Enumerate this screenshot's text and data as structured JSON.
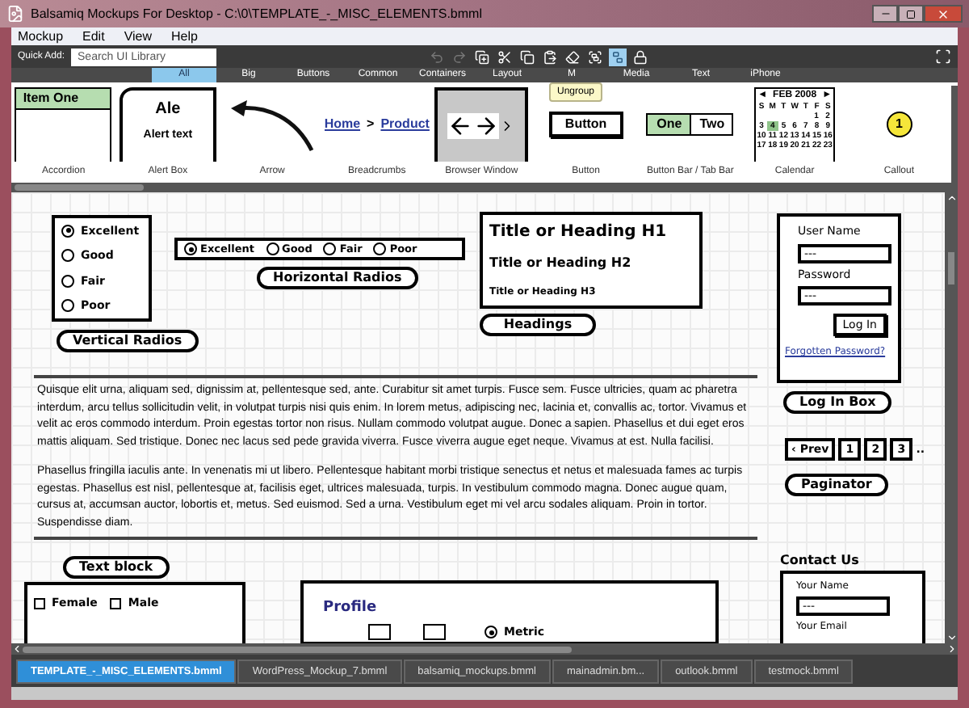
{
  "window": {
    "title": "Balsamiq Mockups For Desktop - C:\\0\\TEMPLATE_-_MISC_ELEMENTS.bmml"
  },
  "menu": [
    "Mockup",
    "Edit",
    "View",
    "Help"
  ],
  "quick_add": {
    "label": "Quick Add:",
    "placeholder": "Search UI Library"
  },
  "toolbar": [
    {
      "kind": "undo",
      "disabled": true,
      "selected": false
    },
    {
      "kind": "redo",
      "disabled": true,
      "selected": false
    },
    {
      "kind": "clone",
      "disabled": false,
      "selected": false
    },
    {
      "kind": "cut",
      "disabled": false,
      "selected": false
    },
    {
      "kind": "copy",
      "disabled": false,
      "selected": false
    },
    {
      "kind": "paste",
      "disabled": false,
      "selected": false
    },
    {
      "kind": "eraser",
      "disabled": false,
      "selected": false
    },
    {
      "kind": "group",
      "disabled": false,
      "selected": false
    },
    {
      "kind": "ungroup",
      "disabled": false,
      "selected": true
    },
    {
      "kind": "lock",
      "disabled": false,
      "selected": false
    }
  ],
  "tooltip": "Ungroup",
  "categories": [
    {
      "label": "All",
      "selected": true
    },
    {
      "label": "Big",
      "selected": false
    },
    {
      "label": "Buttons",
      "selected": false
    },
    {
      "label": "Common",
      "selected": false
    },
    {
      "label": "Containers",
      "selected": false
    },
    {
      "label": "Layout",
      "selected": false
    },
    {
      "label": "M",
      "selected": false
    },
    {
      "label": "Media",
      "selected": false
    },
    {
      "label": "Text",
      "selected": false
    },
    {
      "label": "iPhone",
      "selected": false
    }
  ],
  "library": [
    {
      "kind": "accordion",
      "label": "Accordion",
      "item": "Item One"
    },
    {
      "kind": "alert",
      "label": "Alert Box",
      "title": "Ale",
      "text": "Alert text"
    },
    {
      "kind": "arrow",
      "label": "Arrow"
    },
    {
      "kind": "breadcrumbs",
      "label": "Breadcrumbs",
      "links": [
        "Home",
        "Product"
      ],
      "separator": ">"
    },
    {
      "kind": "browser",
      "label": "Browser Window"
    },
    {
      "kind": "button",
      "label": "Button",
      "text": "Button"
    },
    {
      "kind": "button_bar",
      "label": "Button Bar / Tab Bar",
      "buttons": [
        {
          "text": "One",
          "selected": true
        },
        {
          "text": "Two",
          "selected": false
        }
      ]
    },
    {
      "kind": "calendar",
      "label": "Calendar",
      "prev": "◄",
      "month": "FEB 2008",
      "next": "►",
      "weekdays": [
        "S",
        "M",
        "T",
        "W",
        "T",
        "F",
        "S"
      ],
      "weeks": [
        [
          {
            "d": "1",
            "selected": false
          },
          {
            "d": "2",
            "selected": false
          }
        ],
        [
          {
            "d": "3",
            "selected": false
          },
          {
            "d": "4",
            "selected": true
          },
          {
            "d": "5",
            "selected": false
          },
          {
            "d": "6",
            "selected": false
          },
          {
            "d": "7",
            "selected": false
          },
          {
            "d": "8",
            "selected": false
          },
          {
            "d": "9",
            "selected": false
          }
        ],
        [
          {
            "d": "10",
            "selected": false
          },
          {
            "d": "11",
            "selected": false
          },
          {
            "d": "12",
            "selected": false
          },
          {
            "d": "13",
            "selected": false
          },
          {
            "d": "14",
            "selected": false
          },
          {
            "d": "15",
            "selected": false
          },
          {
            "d": "16",
            "selected": false
          }
        ],
        [
          {
            "d": "17",
            "selected": false
          },
          {
            "d": "18",
            "selected": false
          },
          {
            "d": "19",
            "selected": false
          },
          {
            "d": "20",
            "selected": false
          },
          {
            "d": "21",
            "selected": false
          },
          {
            "d": "22",
            "selected": false
          },
          {
            "d": "23",
            "selected": false
          }
        ]
      ]
    },
    {
      "kind": "callout",
      "label": "Callout",
      "text": "1"
    }
  ],
  "canvas": {
    "vertical_radios": {
      "options": [
        {
          "label": "Excellent",
          "selected": true
        },
        {
          "label": "Good",
          "selected": false
        },
        {
          "label": "Fair",
          "selected": false
        },
        {
          "label": "Poor",
          "selected": false
        }
      ],
      "note": "Vertical Radios"
    },
    "horizontal_radios": {
      "options": [
        {
          "label": "Excellent",
          "selected": true
        },
        {
          "label": "Good",
          "selected": false
        },
        {
          "label": "Fair",
          "selected": false
        },
        {
          "label": "Poor",
          "selected": false
        }
      ],
      "note": "Horizontal Radios"
    },
    "headings": {
      "h1": "Title or Heading H1",
      "h2": "Title or Heading H2",
      "h3": "Title or Heading H3",
      "note": "Headings"
    },
    "login": {
      "username_label": "User Name",
      "username_value": "---",
      "password_label": "Password",
      "password_value": "---",
      "button": "Log In",
      "link": "Forgotten Password?",
      "note": "Log In Box"
    },
    "paginator": {
      "prev": "‹ Prev",
      "pages": [
        "1",
        "2",
        "3"
      ],
      "more": "..",
      "note": "Paginator"
    },
    "text_block": {
      "paragraphs": [
        "Quisque elit urna, aliquam sed, dignissim at, pellentesque sed, ante. Curabitur sit amet turpis. Fusce sem. Fusce ultricies, quam ac pharetra interdum, arcu tellus sollicitudin velit, in volutpat turpis nisi quis enim. In lorem metus, adipiscing nec, lacinia et, convallis ac, tortor. Vivamus et velit ac eros commodo interdum. Proin egestas tortor non risus. Nullam commodo volutpat augue. Donec a sapien. Phasellus et dui eget eros mattis aliquam. Sed tristique. Donec nec lacus sed pede gravida viverra. Fusce viverra augue eget neque. Vivamus at est. Nulla facilisi.",
        "Phasellus fringilla iaculis ante. In venenatis mi ut libero. Pellentesque habitant morbi tristique senectus et netus et malesuada fames ac turpis egestas. Phasellus est nisl, pellentesque at, facilisis eget, ultrices malesuada, turpis. In vestibulum commodo magna. Donec augue quam, cursus at, accumsan auctor, lobortis et, metus. Sed euismod. Sed a urna. Vestibulum eget mi vel arcu sodales aliquam. Proin in tortor. Suspendisse diam."
      ],
      "note": "Text block"
    },
    "contact": {
      "title": "Contact Us",
      "name_label": "Your Name",
      "name_value": "---",
      "email_label": "Your Email"
    },
    "gender": [
      {
        "label": "Female",
        "checked": false
      },
      {
        "label": "Male",
        "checked": false
      }
    ],
    "profile": {
      "title": "Profile",
      "units": [
        {
          "label": "Metric",
          "selected": true
        }
      ]
    }
  },
  "file_tabs": [
    {
      "label": "TEMPLATE_-_MISC_ELEMENTS.bmml",
      "selected": true
    },
    {
      "label": "WordPress_Mockup_7.bmml",
      "selected": false
    },
    {
      "label": "balsamiq_mockups.bmml",
      "selected": false
    },
    {
      "label": "mainadmin.bm...",
      "selected": false
    },
    {
      "label": "outlook.bmml",
      "selected": false
    },
    {
      "label": "testmock.bmml",
      "selected": false
    }
  ]
}
